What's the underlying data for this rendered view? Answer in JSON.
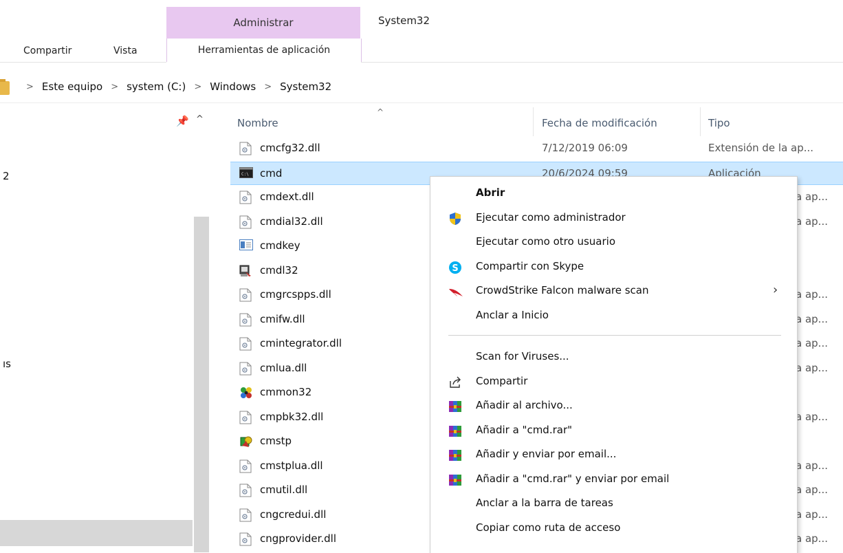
{
  "window": {
    "title": "System32"
  },
  "ribbon": {
    "context_header": "Administrar",
    "tabs": [
      "Compartir",
      "Vista"
    ],
    "tools_tab": "Herramientas de aplicación"
  },
  "address": {
    "crumbs": [
      "Este equipo",
      "system (C:)",
      "Windows",
      "System32"
    ]
  },
  "nav": {
    "fragments": [
      "2",
      "ıs"
    ]
  },
  "columns": {
    "name": "Nombre",
    "date": "Fecha de modificación",
    "type": "Tipo"
  },
  "files": [
    {
      "name": "cmcfg32.dll",
      "date": "7/12/2019 06:09",
      "type": "Extensión de la ap...",
      "icon": "dll-icon"
    },
    {
      "name": "cmd",
      "date": "20/6/2024 09:59",
      "type": "Aplicación",
      "icon": "cmd-icon",
      "selected": true
    },
    {
      "name": "cmdext.dll",
      "type": "a ap...",
      "icon": "dll-icon"
    },
    {
      "name": "cmdial32.dll",
      "type": "a ap...",
      "icon": "dll-icon"
    },
    {
      "name": "cmdkey",
      "icon": "cmdkey-icon"
    },
    {
      "name": "cmdl32",
      "icon": "cmdl32-icon"
    },
    {
      "name": "cmgrcspps.dll",
      "type": "a ap...",
      "icon": "dll-icon"
    },
    {
      "name": "cmifw.dll",
      "type": "a ap...",
      "icon": "dll-icon"
    },
    {
      "name": "cmintegrator.dll",
      "type": "a ap...",
      "icon": "dll-icon"
    },
    {
      "name": "cmlua.dll",
      "type": "a ap...",
      "icon": "dll-icon"
    },
    {
      "name": "cmmon32",
      "icon": "cmmon32-icon"
    },
    {
      "name": "cmpbk32.dll",
      "type": "a ap...",
      "icon": "dll-icon"
    },
    {
      "name": "cmstp",
      "icon": "cmstp-icon"
    },
    {
      "name": "cmstplua.dll",
      "type": "a ap...",
      "icon": "dll-icon"
    },
    {
      "name": "cmutil.dll",
      "type": "a ap...",
      "icon": "dll-icon"
    },
    {
      "name": "cngcredui.dll",
      "type": "a ap...",
      "icon": "dll-icon"
    },
    {
      "name": "cngprovider.dll",
      "type": "a ap...",
      "icon": "dll-icon"
    }
  ],
  "context_menu": {
    "items": [
      {
        "label": "Abrir",
        "bold": true
      },
      {
        "label": "Ejecutar como administrador",
        "icon": "uac-shield-icon"
      },
      {
        "label": "Ejecutar como otro usuario"
      },
      {
        "label": "Compartir con Skype",
        "icon": "skype-icon"
      },
      {
        "label": "CrowdStrike Falcon malware scan",
        "icon": "crowdstrike-icon",
        "submenu": true
      },
      {
        "label": "Anclar a Inicio"
      },
      {
        "separator": true
      },
      {
        "label": "Scan for Viruses..."
      },
      {
        "label": "Compartir",
        "icon": "share-icon"
      },
      {
        "label": "Añadir al archivo...",
        "icon": "winrar-icon"
      },
      {
        "label": "Añadir a \"cmd.rar\"",
        "icon": "winrar-icon"
      },
      {
        "label": "Añadir y enviar por email...",
        "icon": "winrar-icon"
      },
      {
        "label": "Añadir a \"cmd.rar\" y enviar por email",
        "icon": "winrar-icon"
      },
      {
        "label": "Anclar a la barra de tareas"
      },
      {
        "label": "Copiar como ruta de acceso"
      }
    ]
  },
  "colors": {
    "selection": "#cce8ff",
    "context_tab": "#e8c8f0",
    "folder": "#e8b84a"
  }
}
